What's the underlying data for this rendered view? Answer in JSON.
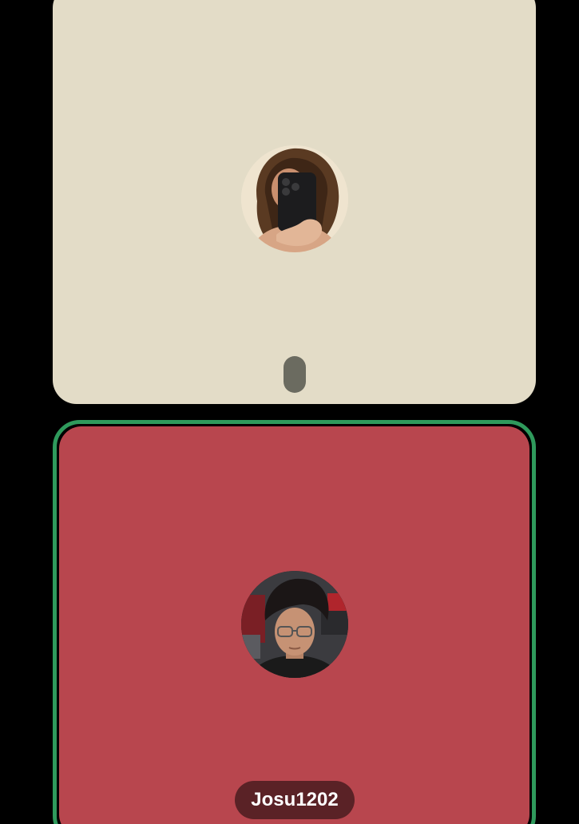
{
  "participants": [
    {
      "role": "remote",
      "tile_color": "#e3dcc7",
      "avatar_icon": "selfie-avatar-icon"
    },
    {
      "role": "speaking",
      "tile_color": "#b8464e",
      "border_color": "#2f9a5c",
      "name": "Josu1202",
      "avatar_icon": "user-avatar-icon"
    }
  ],
  "colors": {
    "background": "#000000",
    "handle": "#6b6b60",
    "name_badge": "#5a2226"
  }
}
